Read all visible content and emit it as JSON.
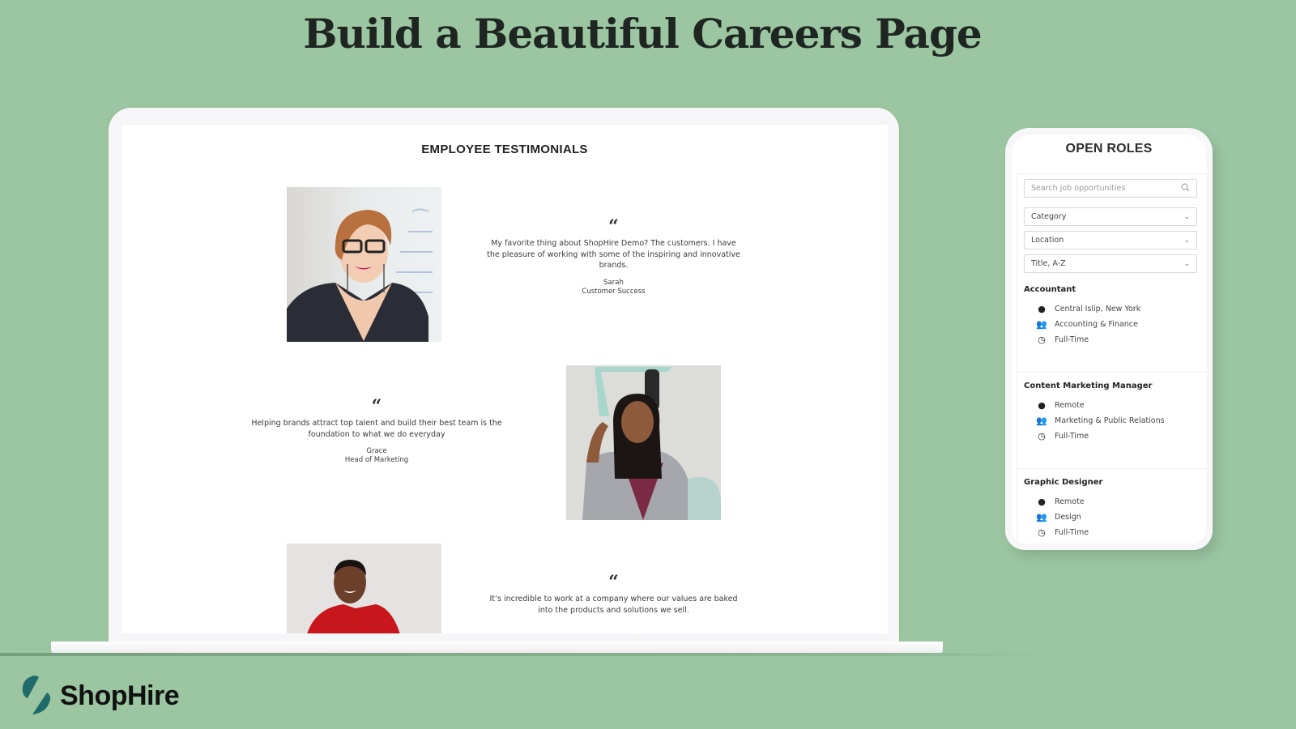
{
  "hero": {
    "title": "Build a Beautiful Careers Page"
  },
  "laptop": {
    "section_title": "EMPLOYEE TESTIMONIALS",
    "testimonials": [
      {
        "quote_mark": "“",
        "text": "My favorite thing about ShopHire Demo? The customers. I have the pleasure of working with some of the inspiring and innovative brands.",
        "name": "Sarah",
        "role": "Customer Success",
        "photo": "woman-with-glasses-photo"
      },
      {
        "quote_mark": "“",
        "text": "Helping brands attract top talent and build their best team is the foundation to what we do everyday",
        "name": "Grace",
        "role": "Head of Marketing",
        "photo": "woman-in-blazer-photo"
      },
      {
        "quote_mark": "“",
        "text": "It’s incredible to work at a company where our values are baked into the products and solutions we sell.",
        "name": "",
        "role": "",
        "photo": "man-in-red-shirt-photo"
      }
    ]
  },
  "phone": {
    "title": "OPEN ROLES",
    "search": {
      "placeholder": "Search job opportunities",
      "icon": "search-icon"
    },
    "filters": [
      {
        "label": "Category",
        "icon": "chevron-down-icon"
      },
      {
        "label": "Location",
        "icon": "chevron-down-icon"
      },
      {
        "label": "Title, A-Z",
        "icon": "chevron-down-icon"
      }
    ],
    "jobs": [
      {
        "title": "Accountant",
        "location": "Central Islip, New York",
        "department": "Accounting & Finance",
        "type": "Full-Time"
      },
      {
        "title": "Content Marketing Manager",
        "location": "Remote",
        "department": "Marketing & Public Relations",
        "type": "Full-Time"
      },
      {
        "title": "Graphic Designer",
        "location": "Remote",
        "department": "Design",
        "type": "Full-Time"
      }
    ],
    "icons": {
      "location": "map-pin-icon",
      "department": "people-icon",
      "type": "clock-icon"
    }
  },
  "brand": {
    "name": "ShopHire",
    "color": "#1f6b6b"
  },
  "colors": {
    "background": "#9cc6a1",
    "title": "#1f2622"
  }
}
